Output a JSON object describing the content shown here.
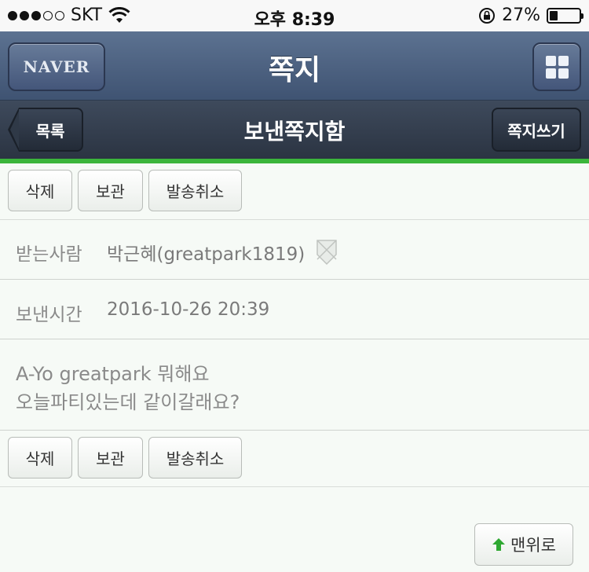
{
  "status_bar": {
    "carrier": "SKT",
    "time": "오후 8:39",
    "battery_percent": "27%",
    "battery_level": 0.27,
    "signal_bars": 3
  },
  "header": {
    "logo_label": "NAVER",
    "title": "쪽지"
  },
  "subheader": {
    "back_label": "목록",
    "title": "보낸쪽지함",
    "write_label": "쪽지쓰기"
  },
  "actions": {
    "delete_label": "삭제",
    "keep_label": "보관",
    "cancel_send_label": "발송취소"
  },
  "details": {
    "recipient_label": "받는사람",
    "recipient_value": "박근혜(greatpark1819)",
    "sent_time_label": "보낸시간",
    "sent_time_value": "2016-10-26 20:39"
  },
  "message": {
    "line1": "A-Yo greatpark 뭐해요",
    "line2": "오늘파티있는데 같이갈래요?"
  },
  "footer": {
    "top_label": "맨위로"
  },
  "colors": {
    "accent_green": "#3bb53b",
    "header_blue": "#4b5f80",
    "subheader_dark": "#2f3947"
  }
}
